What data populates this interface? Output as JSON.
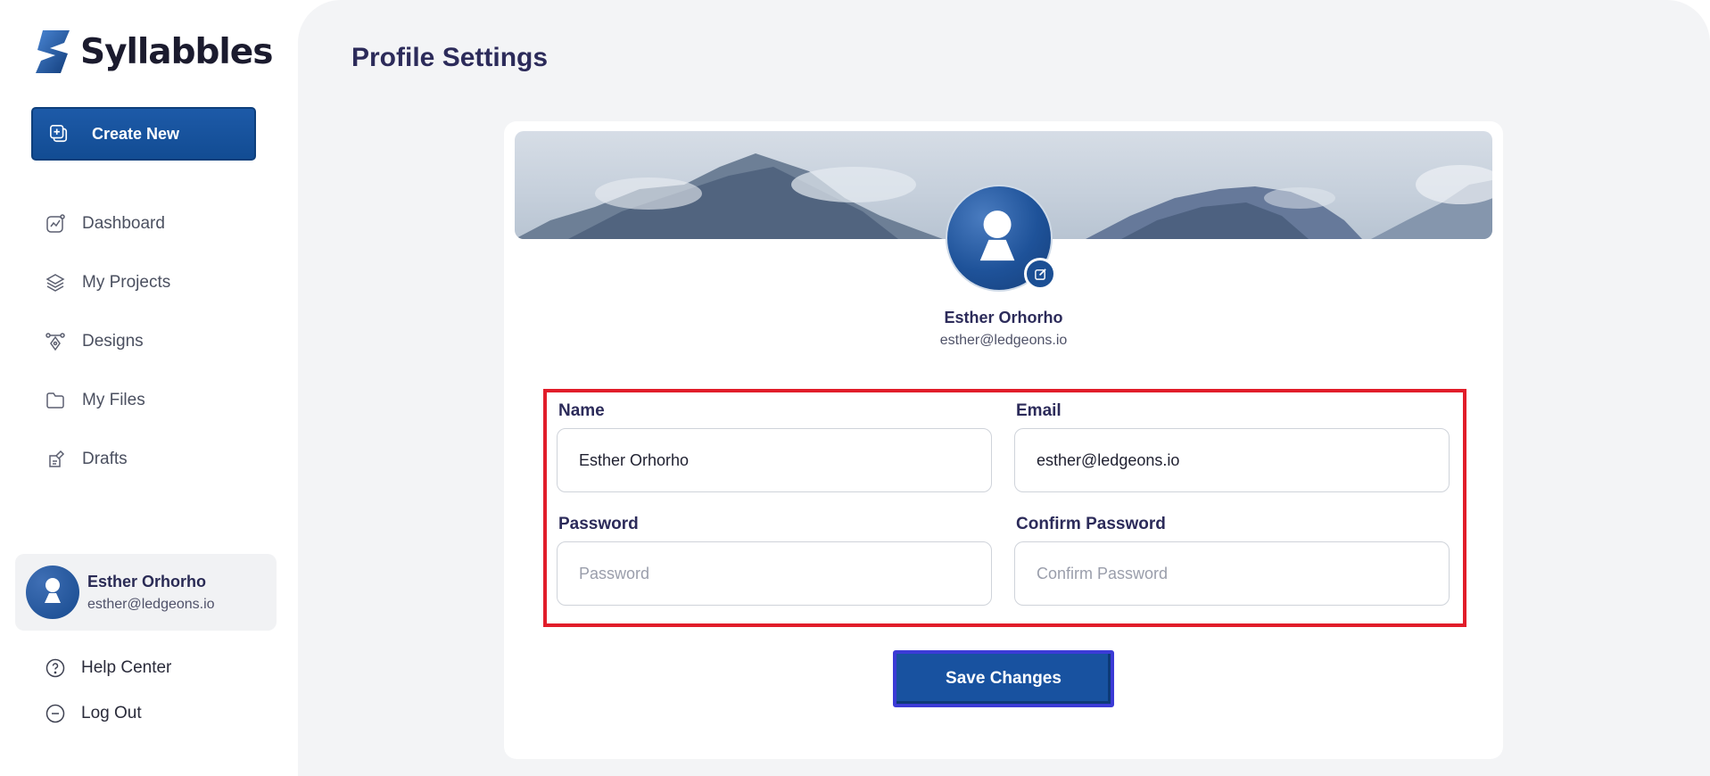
{
  "app": {
    "name": "Syllabbles"
  },
  "sidebar": {
    "create_label": "Create New",
    "items": [
      {
        "label": "Dashboard",
        "icon": "chart-icon"
      },
      {
        "label": "My Projects",
        "icon": "layers-icon"
      },
      {
        "label": "Designs",
        "icon": "pen-tool-icon"
      },
      {
        "label": "My Files",
        "icon": "folder-icon"
      },
      {
        "label": "Drafts",
        "icon": "drafts-icon"
      }
    ],
    "user": {
      "name": "Esther Orhorho",
      "email": "esther@ledgeons.io"
    },
    "bottom": [
      {
        "label": "Help Center",
        "icon": "help-icon"
      },
      {
        "label": "Log Out",
        "icon": "logout-icon"
      }
    ]
  },
  "main": {
    "title": "Profile Settings",
    "profile": {
      "name": "Esther Orhorho",
      "email": "esther@ledgeons.io"
    },
    "form": {
      "name_label": "Name",
      "name_value": "Esther Orhorho",
      "email_label": "Email",
      "email_value": "esther@ledgeons.io",
      "password_label": "Password",
      "password_placeholder": "Password",
      "confirm_label": "Confirm Password",
      "confirm_placeholder": "Confirm Password"
    },
    "save_label": "Save Changes"
  },
  "colors": {
    "accent": "#1852a0",
    "highlight": "#e11d2a",
    "focus": "#3b3bd6",
    "title": "#2c2b5a"
  }
}
